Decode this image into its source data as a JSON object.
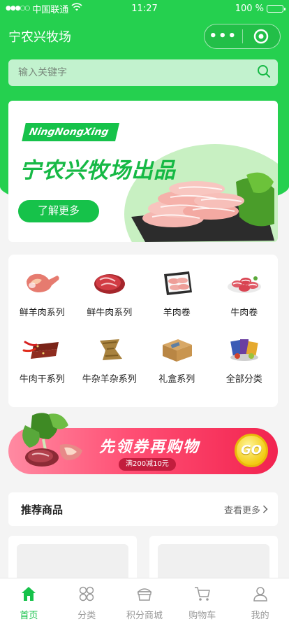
{
  "status": {
    "carrier": "中国联通",
    "time": "11:27",
    "battery": "100 %"
  },
  "nav": {
    "title": "宁农兴牧场",
    "more_icon": "more-dots-icon",
    "close_icon": "target-icon"
  },
  "search": {
    "placeholder": "输入关键字"
  },
  "banner": {
    "brand": "NingNongXing",
    "title": "宁农兴牧场出品",
    "button": "了解更多"
  },
  "categories": [
    {
      "label": "鲜羊肉系列",
      "icon": "lamb-leg-icon"
    },
    {
      "label": "鲜牛肉系列",
      "icon": "beef-steak-icon"
    },
    {
      "label": "羊肉卷",
      "icon": "lamb-roll-icon"
    },
    {
      "label": "牛肉卷",
      "icon": "beef-roll-icon"
    },
    {
      "label": "牛肉干系列",
      "icon": "beef-jerky-icon"
    },
    {
      "label": "牛杂羊杂系列",
      "icon": "tripe-icon"
    },
    {
      "label": "礼盒系列",
      "icon": "gift-box-icon"
    },
    {
      "label": "全部分类",
      "icon": "all-categories-icon"
    }
  ],
  "coupon": {
    "title": "先领券再购物",
    "subtitle": "满200减10元",
    "button": "GO"
  },
  "recommend": {
    "title": "推荐商品",
    "more": "查看更多"
  },
  "tabbar": [
    {
      "label": "首页",
      "icon": "home-icon",
      "active": true
    },
    {
      "label": "分类",
      "icon": "category-icon",
      "active": false
    },
    {
      "label": "积分商城",
      "icon": "points-store-icon",
      "active": false
    },
    {
      "label": "购物车",
      "icon": "cart-icon",
      "active": false
    },
    {
      "label": "我的",
      "icon": "user-icon",
      "active": false
    }
  ],
  "colors": {
    "brand": "#25d04f",
    "accent": "#16c24a",
    "coupon": "#f2234f",
    "go": "#f3cc14"
  }
}
